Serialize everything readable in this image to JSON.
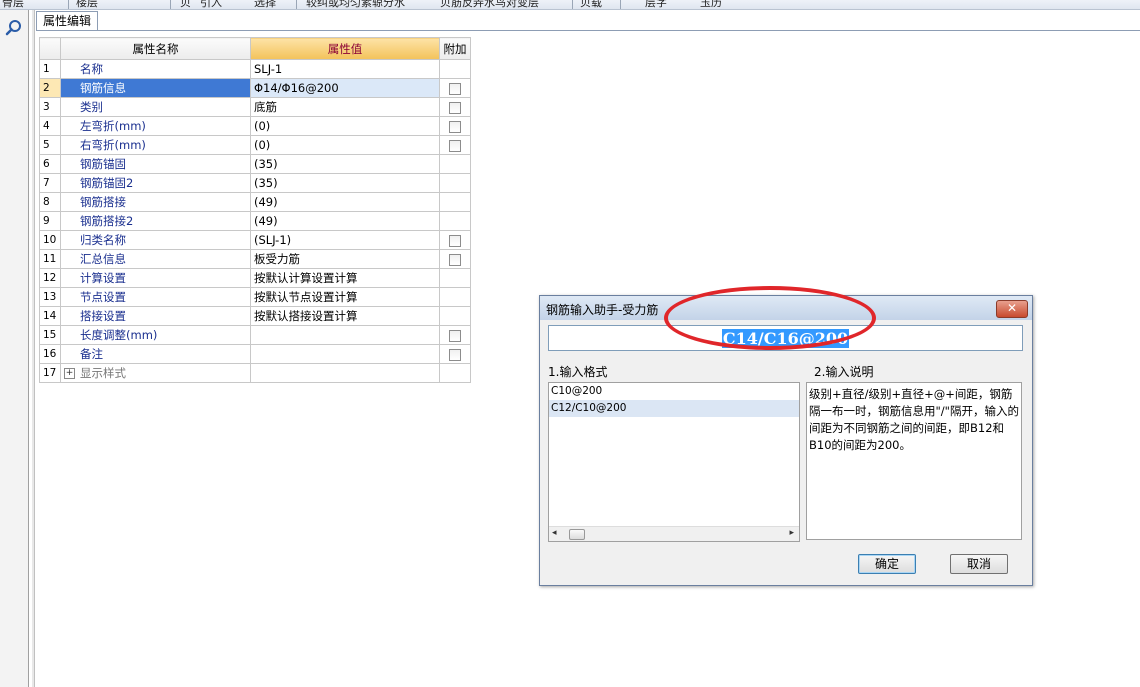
{
  "toolbar": {
    "items": [
      "骨层",
      "楼层",
      "贝",
      "引入",
      "选择",
      "较纠或均匀素辌分水",
      "贝筋反弄水鸟对变层",
      "贝载",
      "层字",
      "玉历"
    ]
  },
  "panel": {
    "tab_label": "属性编辑",
    "search_icon": "search-icon"
  },
  "table": {
    "headers": {
      "idx": "",
      "name": "属性名称",
      "value": "属性值",
      "extra": "附加"
    },
    "rows": [
      {
        "idx": "1",
        "name": "名称",
        "value": "SLJ-1",
        "checkbox": false
      },
      {
        "idx": "2",
        "name": "钢筋信息",
        "value": "Φ14/Φ16@200",
        "checkbox": true,
        "selected": true
      },
      {
        "idx": "3",
        "name": "类别",
        "value": "底筋",
        "checkbox": true
      },
      {
        "idx": "4",
        "name": "左弯折(mm)",
        "value": "(0)",
        "checkbox": true
      },
      {
        "idx": "5",
        "name": "右弯折(mm)",
        "value": "(0)",
        "checkbox": true
      },
      {
        "idx": "6",
        "name": "钢筋锚固",
        "value": "(35)",
        "checkbox": false
      },
      {
        "idx": "7",
        "name": "钢筋锚固2",
        "value": "(35)",
        "checkbox": false
      },
      {
        "idx": "8",
        "name": "钢筋搭接",
        "value": "(49)",
        "checkbox": false
      },
      {
        "idx": "9",
        "name": "钢筋搭接2",
        "value": "(49)",
        "checkbox": false
      },
      {
        "idx": "10",
        "name": "归类名称",
        "value": "(SLJ-1)",
        "checkbox": true
      },
      {
        "idx": "11",
        "name": "汇总信息",
        "value": "板受力筋",
        "checkbox": true
      },
      {
        "idx": "12",
        "name": "计算设置",
        "value": "按默认计算设置计算",
        "checkbox": false
      },
      {
        "idx": "13",
        "name": "节点设置",
        "value": "按默认节点设置计算",
        "checkbox": false
      },
      {
        "idx": "14",
        "name": "搭接设置",
        "value": "按默认搭接设置计算",
        "checkbox": false
      },
      {
        "idx": "15",
        "name": "长度调整(mm)",
        "value": "",
        "checkbox": true
      },
      {
        "idx": "16",
        "name": "备注",
        "value": "",
        "checkbox": true
      },
      {
        "idx": "17",
        "name": "显示样式",
        "value": "",
        "checkbox": false,
        "expandable": true,
        "expander": "+"
      }
    ]
  },
  "dialog": {
    "title": "钢筋输入助手-受力筋",
    "close_label": "✕",
    "input_value": "C14/C16@200",
    "format_label": "1.输入格式",
    "desc_label": "2.输入说明",
    "formats": [
      "C10@200",
      "C12/C10@200"
    ],
    "description": "级别+直径/级别+直径+@+间距，钢筋隔一布一时，钢筋信息用\"/\"隔开，输入的间距为不同钢筋之间的间距，即B12和B10的间距为200。",
    "ok_label": "确定",
    "cancel_label": "取消",
    "scroll_left": "◂",
    "scroll_right": "▸"
  },
  "colors": {
    "highlight": "#3399ff",
    "annotation": "#e0262a",
    "selected_row": "#3f79d4",
    "value_header": "#f3c25a"
  }
}
